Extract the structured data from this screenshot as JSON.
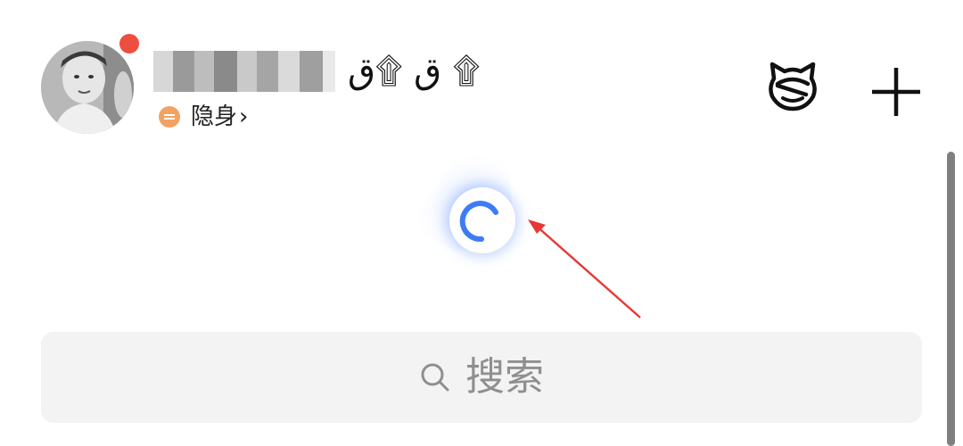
{
  "header": {
    "name_suffix": "ق ۩ق ۩",
    "status_label": "隐身",
    "status_chevron": "›",
    "status_color": "#f4a261",
    "notification_color": "#ee4e3f"
  },
  "icons": {
    "avatar": "avatar-photo",
    "status": "status-invisible-icon",
    "header_right": [
      "cat-face-icon",
      "plus-icon"
    ],
    "search": "search-icon"
  },
  "loading": {
    "spinner_color": "#3d7cf5"
  },
  "search": {
    "placeholder": "搜索"
  }
}
